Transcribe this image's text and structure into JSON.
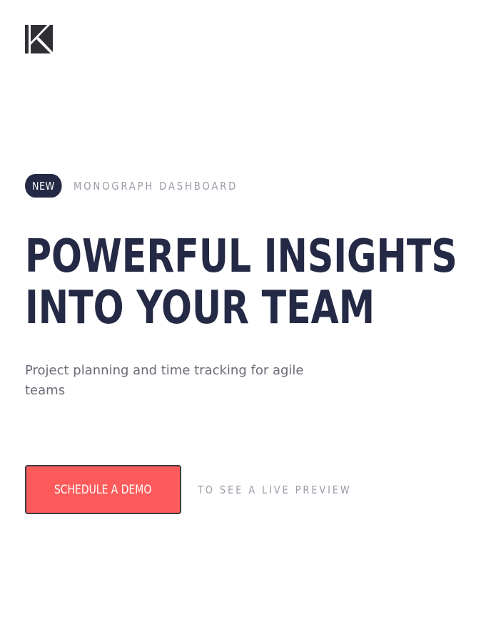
{
  "logo": {
    "icon": "k-logo-icon",
    "color": "#242a45"
  },
  "hero": {
    "badge": "NEW",
    "tagline": "MONOGRAPH DASHBOARD",
    "headline_line1": "POWERFUL INSIGHTS",
    "headline_line2": "INTO YOUR TEAM",
    "subtitle": "Project planning and time tracking for agile teams"
  },
  "cta": {
    "button_label": "SCHEDULE A DEMO",
    "preview_text": "TO SEE A LIVE PREVIEW"
  },
  "colors": {
    "primary_dark": "#242a45",
    "accent": "#fd5b5b",
    "muted_text": "#9a9ca8",
    "body_text": "#6a6c77",
    "background": "#ffffff"
  }
}
